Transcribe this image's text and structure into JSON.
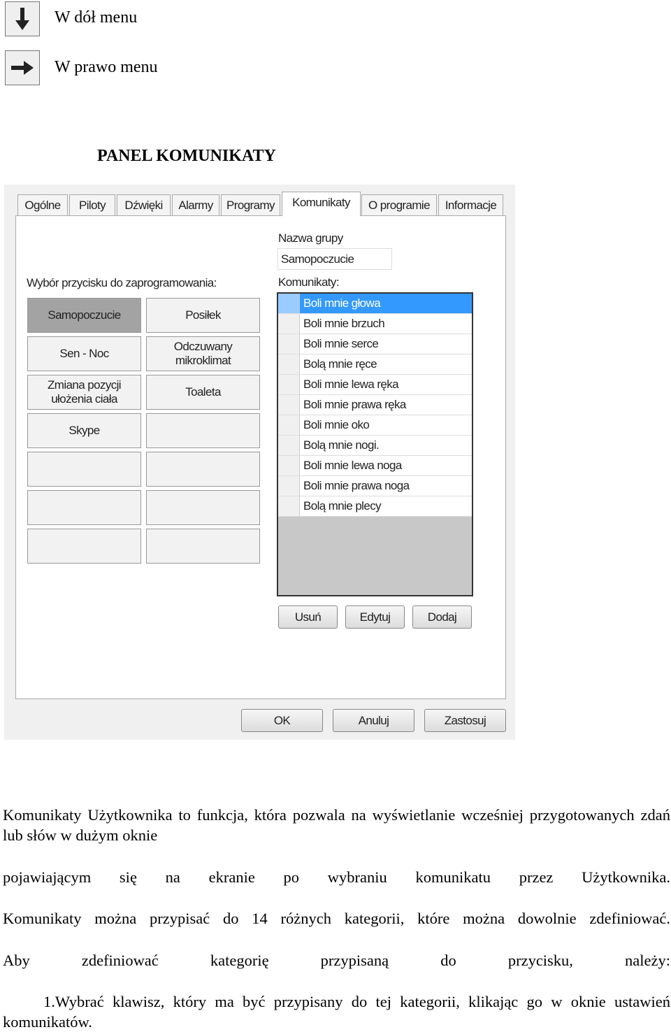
{
  "legend": [
    {
      "icon": "arrow-down-icon",
      "label": "W dół menu"
    },
    {
      "icon": "arrow-right-icon",
      "label": "W prawo menu"
    }
  ],
  "heading": "PANEL KOMUNIKATY",
  "dialog": {
    "tabs": [
      "Ogólne",
      "Piloty",
      "Dźwięki",
      "Alarmy",
      "Programy",
      "Komunikaty",
      "O programie",
      "Informacje"
    ],
    "active_tab": "Komunikaty",
    "button_select_label": "Wybór przycisku do zaprogramowania:",
    "grid_buttons": [
      "Samopoczucie",
      "Posiłek",
      "Sen - Noc",
      "Odczuwany mikroklimat",
      "Zmiana pozycji ułożenia ciała",
      "Toaleta",
      "Skype",
      "",
      "",
      "",
      "",
      "",
      "",
      ""
    ],
    "group_name_label": "Nazwa grupy",
    "group_name_value": "Samopoczucie",
    "messages_label": "Komunikaty:",
    "messages": [
      "Boli mnie głowa",
      "Boli mnie brzuch",
      "Boli mnie serce",
      "Bolą mnie ręce",
      "Boli mnie lewa ręka",
      "Boli mnie prawa ręka",
      "Boli mnie oko",
      "Bolą mnie nogi.",
      "Boli mnie lewa noga",
      "Boli mnie prawa noga",
      "Bolą mnie plecy"
    ],
    "list_buttons": [
      "Usuń",
      "Edytuj",
      "Dodaj"
    ],
    "footer_buttons": [
      "OK",
      "Anuluj",
      "Zastosuj"
    ],
    "selected_color": "#3399ff"
  },
  "paragraphs": [
    "Komunikaty Użytkownika to funkcja, która pozwala na wyświetlanie wcześniej przygotowanych zdań lub słów w dużym oknie",
    "pojawiającym się na ekranie po wybraniu komunikatu przez Użytkownika.",
    "Komunikaty można przypisać do 14 różnych kategorii, które można dowolnie zdefiniować.",
    "Aby zdefiniować kategorię przypisaną do przycisku, należy:",
    "1.Wybrać klawisz, który ma być przypisany do tej kategorii, klikając go w oknie ustawień komunikatów."
  ]
}
